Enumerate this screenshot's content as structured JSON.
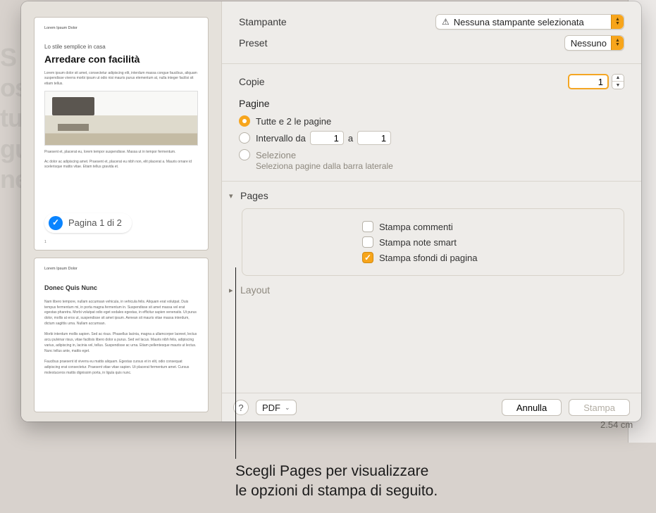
{
  "preview": {
    "doc_header": "Lorem Ipsum Dolor",
    "kicker": "Lo stile semplice in casa",
    "title": "Arredare con facilità",
    "badge": "Pagina 1 di 2",
    "page2_subtitle": "Donec Quis Nunc"
  },
  "printer": {
    "label": "Stampante",
    "value": "Nessuna stampante selezionata"
  },
  "preset": {
    "label": "Preset",
    "value": "Nessuno"
  },
  "copies": {
    "label": "Copie",
    "value": "1"
  },
  "pages": {
    "group_label": "Pagine",
    "all_label": "Tutte e 2 le pagine",
    "range_label": "Intervallo da",
    "range_from": "1",
    "range_sep": "a",
    "range_to": "1",
    "selection_label": "Selezione",
    "selection_hint": "Seleziona pagine dalla barra laterale"
  },
  "appsection": {
    "title": "Pages",
    "opt_comments": "Stampa commenti",
    "opt_notes": "Stampa note smart",
    "opt_backgrounds": "Stampa sfondi di pagina"
  },
  "layout_section": "Layout",
  "footer": {
    "pdf": "PDF",
    "cancel": "Annulla",
    "print": "Stampa"
  },
  "callout": {
    "line1": "Scegli Pages per visualizzare",
    "line2": "le opzioni di stampa di seguito."
  },
  "strip_value": "2.54 cm"
}
